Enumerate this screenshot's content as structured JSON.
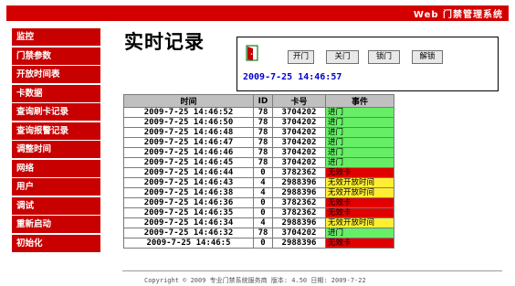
{
  "header": {
    "title": "Web 门禁管理系统"
  },
  "sidebar": {
    "items": [
      {
        "label": "监控"
      },
      {
        "label": "门禁参数"
      },
      {
        "label": "开放时间表"
      },
      {
        "label": "卡数据"
      },
      {
        "label": "查询刷卡记录"
      },
      {
        "label": "查询报警记录"
      },
      {
        "label": "调整时间"
      },
      {
        "label": "网络"
      },
      {
        "label": "用户"
      },
      {
        "label": "调试"
      },
      {
        "label": "重新启动"
      },
      {
        "label": "初始化"
      }
    ]
  },
  "main": {
    "title": "实时记录",
    "door_panel": {
      "buttons": {
        "open": "开门",
        "close": "关门",
        "lock": "锁门",
        "unlock": "解锁"
      },
      "datetime": "2009-7-25 14:46:57"
    },
    "table": {
      "headers": {
        "time": "时间",
        "id": "ID",
        "card": "卡号",
        "event": "事件"
      },
      "rows": [
        {
          "time": "2009-7-25 14:46:52",
          "id": "78",
          "card": "3704202",
          "event": "进门",
          "color": "#66ee66"
        },
        {
          "time": "2009-7-25 14:46:50",
          "id": "78",
          "card": "3704202",
          "event": "进门",
          "color": "#66ee66"
        },
        {
          "time": "2009-7-25 14:46:48",
          "id": "78",
          "card": "3704202",
          "event": "进门",
          "color": "#66ee66"
        },
        {
          "time": "2009-7-25 14:46:47",
          "id": "78",
          "card": "3704202",
          "event": "进门",
          "color": "#66ee66"
        },
        {
          "time": "2009-7-25 14:46:46",
          "id": "78",
          "card": "3704202",
          "event": "进门",
          "color": "#66ee66"
        },
        {
          "time": "2009-7-25 14:46:45",
          "id": "78",
          "card": "3704202",
          "event": "进门",
          "color": "#66ee66"
        },
        {
          "time": "2009-7-25 14:46:44",
          "id": "0",
          "card": "3782362",
          "event": "无效卡",
          "color": "#e00000"
        },
        {
          "time": "2009-7-25 14:46:43",
          "id": "4",
          "card": "2988396",
          "event": "无效开放时间",
          "color": "#ffee33"
        },
        {
          "time": "2009-7-25 14:46:38",
          "id": "4",
          "card": "2988396",
          "event": "无效开放时间",
          "color": "#ffee33"
        },
        {
          "time": "2009-7-25 14:46:36",
          "id": "0",
          "card": "3782362",
          "event": "无效卡",
          "color": "#e00000"
        },
        {
          "time": "2009-7-25 14:46:35",
          "id": "0",
          "card": "3782362",
          "event": "无效卡",
          "color": "#e00000"
        },
        {
          "time": "2009-7-25 14:46:34",
          "id": "4",
          "card": "2988396",
          "event": "无效开放时间",
          "color": "#ffee33"
        },
        {
          "time": "2009-7-25 14:46:32",
          "id": "78",
          "card": "3704202",
          "event": "进门",
          "color": "#66ee66"
        },
        {
          "time": "2009-7-25 14:46:5",
          "id": "0",
          "card": "2988396",
          "event": "无效卡",
          "color": "#e00000"
        }
      ]
    }
  },
  "footer": {
    "text": "Copyright © 2009 专业门禁系统服务商 版本: 4.50 日期: 2009-7-22"
  },
  "colors": {
    "brand_red": "#d40000",
    "nav_red": "#c80000",
    "datetime_blue": "#0000cc"
  }
}
